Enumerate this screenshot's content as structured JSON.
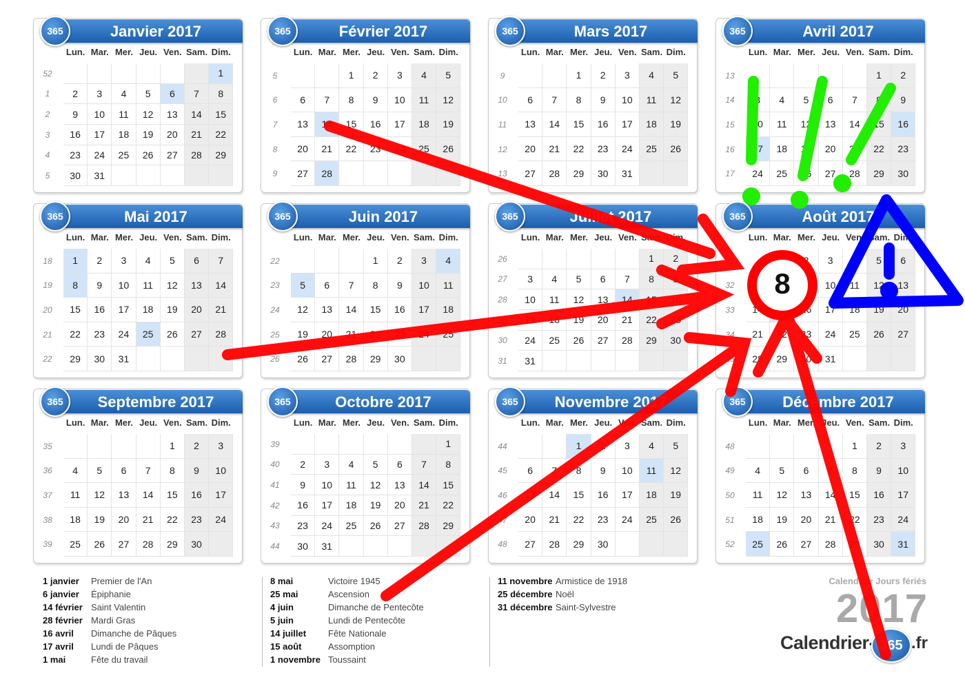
{
  "colors": {
    "banner": "#2f73c4",
    "holiday": "#d2e4f7",
    "weekend": "#ececec",
    "arrow": "#ff0000",
    "marks": "#22ee00",
    "warning": "#0000ff"
  },
  "months": [
    {
      "logo": "365",
      "title": "Janvier 2017",
      "days": [
        "Lun.",
        "Mar.",
        "Mer.",
        "Jeu.",
        "Ven.",
        "Sam.",
        "Dim."
      ],
      "offset": 6,
      "len": 31,
      "weeks": [
        "52",
        "1",
        "2",
        "3",
        "4",
        "5"
      ],
      "holidays": [
        1,
        6
      ]
    },
    {
      "logo": "365",
      "title": "Février 2017",
      "days": [
        "Lun.",
        "Mar.",
        "Mer.",
        "Jeu.",
        "Ven.",
        "Sam.",
        "Dim."
      ],
      "offset": 2,
      "len": 28,
      "weeks": [
        "5",
        "6",
        "7",
        "8",
        "9"
      ],
      "holidays": [
        14,
        28
      ]
    },
    {
      "logo": "365",
      "title": "Mars 2017",
      "days": [
        "Lun.",
        "Mar.",
        "Mer.",
        "Jeu.",
        "Ven.",
        "Sam.",
        "Dim."
      ],
      "offset": 2,
      "len": 31,
      "weeks": [
        "9",
        "10",
        "11",
        "12",
        "13"
      ],
      "holidays": []
    },
    {
      "logo": "365",
      "title": "Avril 2017",
      "days": [
        "Lun.",
        "Mar.",
        "Mer.",
        "Jeu.",
        "Ven.",
        "Sam.",
        "Dim."
      ],
      "offset": 5,
      "len": 30,
      "weeks": [
        "13",
        "14",
        "15",
        "16",
        "17"
      ],
      "holidays": [
        16,
        17
      ]
    },
    {
      "logo": "365",
      "title": "Mai 2017",
      "days": [
        "Lun.",
        "Mar.",
        "Mer.",
        "Jeu.",
        "Ven.",
        "Sam.",
        "Dim."
      ],
      "offset": 0,
      "len": 31,
      "weeks": [
        "18",
        "19",
        "20",
        "21",
        "22"
      ],
      "holidays": [
        1,
        8,
        25
      ]
    },
    {
      "logo": "365",
      "title": "Juin 2017",
      "days": [
        "Lun.",
        "Mar.",
        "Mer.",
        "Jeu.",
        "Ven.",
        "Sam.",
        "Dim."
      ],
      "offset": 3,
      "len": 30,
      "weeks": [
        "22",
        "23",
        "24",
        "25",
        "26"
      ],
      "holidays": [
        4,
        5
      ]
    },
    {
      "logo": "365",
      "title": "Juillet 2017",
      "days": [
        "Lun.",
        "Mar.",
        "Mer.",
        "Jeu.",
        "Ven.",
        "Sam.",
        "Dim."
      ],
      "offset": 5,
      "len": 31,
      "weeks": [
        "26",
        "27",
        "28",
        "29",
        "30",
        "31"
      ],
      "holidays": [
        14
      ]
    },
    {
      "logo": "365",
      "title": "Août 2017",
      "days": [
        "Lun.",
        "Mar.",
        "Mer.",
        "Jeu.",
        "Ven.",
        "Sam.",
        "Dim."
      ],
      "offset": 1,
      "len": 31,
      "weeks": [
        "31",
        "32",
        "33",
        "34",
        "35"
      ],
      "holidays": [
        15
      ]
    },
    {
      "logo": "365",
      "title": "Septembre 2017",
      "days": [
        "Lun.",
        "Mar.",
        "Mer.",
        "Jeu.",
        "Ven.",
        "Sam.",
        "Dim."
      ],
      "offset": 4,
      "len": 30,
      "weeks": [
        "35",
        "36",
        "37",
        "38",
        "39"
      ],
      "holidays": []
    },
    {
      "logo": "365",
      "title": "Octobre 2017",
      "days": [
        "Lun.",
        "Mar.",
        "Mer.",
        "Jeu.",
        "Ven.",
        "Sam.",
        "Dim."
      ],
      "offset": 6,
      "len": 31,
      "weeks": [
        "39",
        "40",
        "41",
        "42",
        "43",
        "44"
      ],
      "holidays": []
    },
    {
      "logo": "365",
      "title": "Novembre 2017",
      "days": [
        "Lun.",
        "Mar.",
        "Mer.",
        "Jeu.",
        "Ven.",
        "Sam.",
        "Dim."
      ],
      "offset": 2,
      "len": 30,
      "weeks": [
        "44",
        "45",
        "46",
        "47",
        "48"
      ],
      "holidays": [
        1,
        11
      ]
    },
    {
      "logo": "365",
      "title": "Décembre 2017",
      "days": [
        "Lun.",
        "Mar.",
        "Mer.",
        "Jeu.",
        "Ven.",
        "Sam.",
        "Dim."
      ],
      "offset": 4,
      "len": 31,
      "weeks": [
        "48",
        "49",
        "50",
        "51",
        "52"
      ],
      "holidays": [
        25,
        31
      ]
    }
  ],
  "legend": [
    [
      {
        "date": "1 janvier",
        "name": "Premier de l'An"
      },
      {
        "date": "6 janvier",
        "name": "Épiphanie"
      },
      {
        "date": "14 février",
        "name": "Saint Valentin"
      },
      {
        "date": "28 février",
        "name": "Mardi Gras"
      },
      {
        "date": "16 avril",
        "name": "Dimanche de Pâques"
      },
      {
        "date": "17 avril",
        "name": "Lundi de Pâques"
      },
      {
        "date": "1 mai",
        "name": "Fête du travail"
      }
    ],
    [
      {
        "date": "8 mai",
        "name": "Victoire 1945"
      },
      {
        "date": "25 mai",
        "name": "Ascension"
      },
      {
        "date": "4 juin",
        "name": "Dimanche de Pentecôte"
      },
      {
        "date": "5 juin",
        "name": "Lundi de Pentecôte"
      },
      {
        "date": "14 juillet",
        "name": "Fête Nationale"
      },
      {
        "date": "15 août",
        "name": "Assomption"
      },
      {
        "date": "1 novembre",
        "name": "Toussaint"
      }
    ],
    [
      {
        "date": "11 novembre",
        "name": "Armistice de 1918"
      },
      {
        "date": "25 décembre",
        "name": "Noël"
      },
      {
        "date": "31 décembre",
        "name": "Saint-Sylvestre"
      }
    ]
  ],
  "brand": {
    "caption": "Calendrier Jours fériés",
    "year": "2017",
    "name": "Calendrier-",
    "circle": "365",
    "tld": ".fr"
  },
  "badge": {
    "number": "8",
    "exclamations": "!!!",
    "warning_mark": "!"
  }
}
